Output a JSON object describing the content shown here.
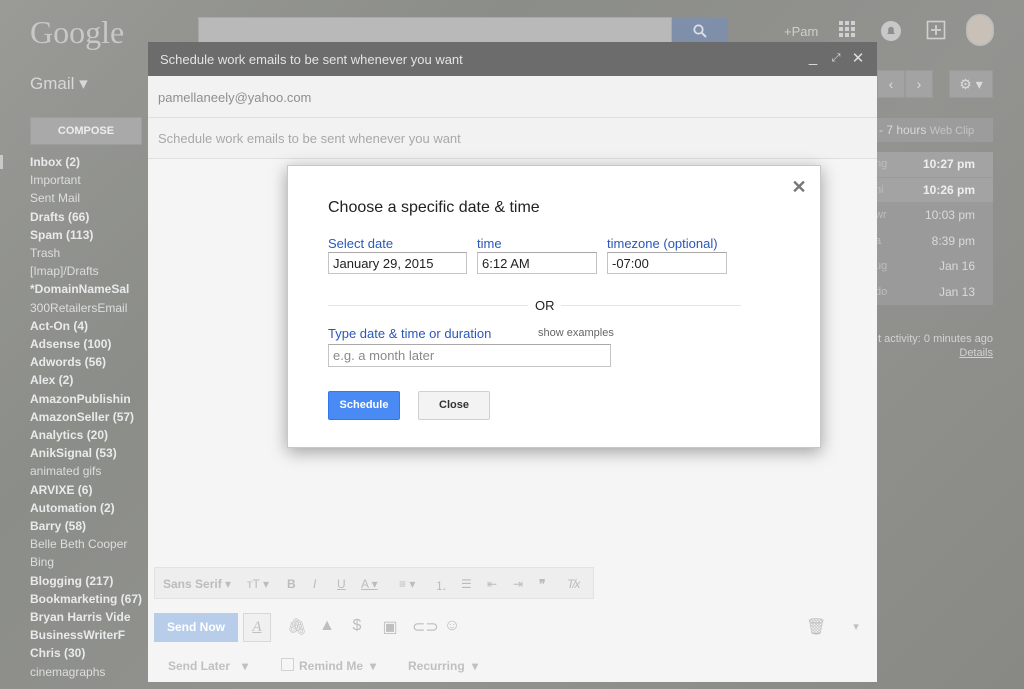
{
  "app": {
    "logo": "Google",
    "gmail_label": "Gmail ▾",
    "compose_label": "COMPOSE",
    "plus_name": "+Pam"
  },
  "sidebar": {
    "items": [
      {
        "label": "Inbox (2)",
        "bold": true
      },
      {
        "label": "Important",
        "bold": false
      },
      {
        "label": "Sent Mail",
        "bold": false
      },
      {
        "label": "Drafts (66)",
        "bold": true
      },
      {
        "label": "Spam (113)",
        "bold": true
      },
      {
        "label": "Trash",
        "bold": false
      },
      {
        "label": "[Imap]/Drafts",
        "bold": false
      },
      {
        "label": "*DomainNameSal",
        "bold": true
      },
      {
        "label": "300RetailersEmail",
        "bold": false
      },
      {
        "label": "Act-On (4)",
        "bold": true
      },
      {
        "label": "Adsense (100)",
        "bold": true
      },
      {
        "label": "Adwords (56)",
        "bold": true
      },
      {
        "label": "Alex (2)",
        "bold": true
      },
      {
        "label": "AmazonPublishin",
        "bold": true
      },
      {
        "label": "AmazonSeller (57)",
        "bold": true
      },
      {
        "label": "Analytics (20)",
        "bold": true
      },
      {
        "label": "AnikSignal (53)",
        "bold": true
      },
      {
        "label": "animated gifs",
        "bold": false
      },
      {
        "label": "ARVIXE (6)",
        "bold": true
      },
      {
        "label": "Automation (2)",
        "bold": true
      },
      {
        "label": "Barry (58)",
        "bold": true
      },
      {
        "label": "Belle Beth Cooper",
        "bold": false
      },
      {
        "label": "Bing",
        "bold": false
      },
      {
        "label": "Blogging (217)",
        "bold": true
      },
      {
        "label": "Bookmarketing (67)",
        "bold": true
      },
      {
        "label": "Bryan Harris Vide",
        "bold": true
      },
      {
        "label": "BusinessWriterF",
        "bold": true
      },
      {
        "label": "Chris (30)",
        "bold": true
      },
      {
        "label": "cinemagraphs",
        "bold": false
      }
    ]
  },
  "right_panel": {
    "webclip": "- 7 hours",
    "webclip_tag": "Web Clip",
    "times": [
      {
        "sender": "ng",
        "time": "10:27 pm",
        "bold": true
      },
      {
        "sender": "ni",
        "time": "10:26 pm",
        "bold": true
      },
      {
        "sender": "wr",
        "time": "10:03 pm",
        "bold": false
      },
      {
        "sender": "a",
        "time": "8:39 pm",
        "bold": false
      },
      {
        "sender": "ug",
        "time": "Jan 16",
        "bold": false
      },
      {
        "sender": "do",
        "time": "Jan 13",
        "bold": false
      }
    ],
    "activity": "t activity: 0 minutes ago",
    "details": "Details"
  },
  "compose": {
    "title": "Schedule work emails to be sent whenever you want",
    "to": "pamellaneely@yahoo.com",
    "subject": "Schedule work emails to be sent whenever you want",
    "font_label": "Sans Serif",
    "send_label": "Send Now",
    "send_later": "Send Later",
    "remind_me": "Remind Me",
    "recurring": "Recurring"
  },
  "dialog": {
    "title": "Choose a specific date & time",
    "date_label": "Select date",
    "date_value": "January 29, 2015",
    "time_label": "time",
    "time_value": "6:12 AM",
    "tz_label": "timezone (optional)",
    "tz_value": "-07:00",
    "or_label": "OR",
    "type_label": "Type date & time or duration",
    "show_examples": "show examples",
    "type_placeholder": "e.g. a month later",
    "schedule_label": "Schedule",
    "close_label": "Close"
  }
}
